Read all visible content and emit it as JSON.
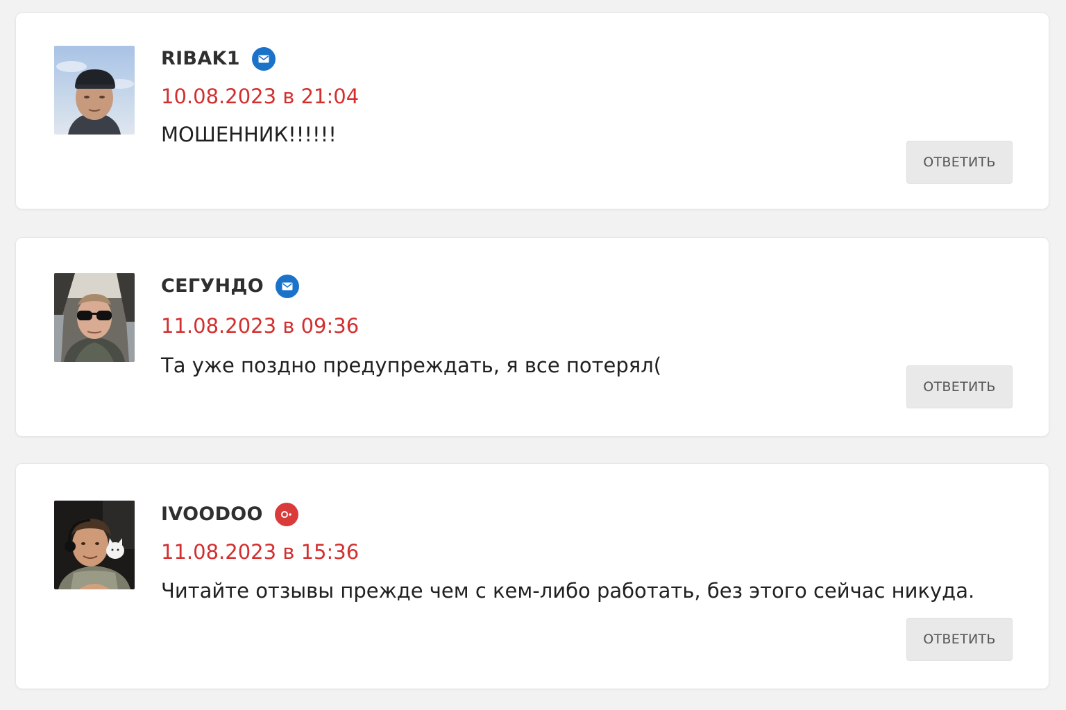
{
  "comments": [
    {
      "author": "RIBAK1",
      "network_icon": "mail-icon",
      "network_color": "#1a73c9",
      "date": "10.08.2023 в 21:04",
      "text": "МОШЕННИК!!!!!!",
      "reply_label": "ОТВЕТИТЬ"
    },
    {
      "author": "СЕГУНДО",
      "network_icon": "mail-icon",
      "network_color": "#1a73c9",
      "date": "11.08.2023 в 09:36",
      "text": "Та уже поздно предупреждать, я все потерял(",
      "reply_label": "ОТВЕТИТЬ"
    },
    {
      "author": "IVOODOO",
      "network_icon": "odnoklassniki-icon",
      "network_color": "#d93b3b",
      "date": "11.08.2023 в 15:36",
      "text": "Читайте отзывы прежде чем с кем-либо работать, без этого сейчас никуда.",
      "reply_label": "ОТВЕТИТЬ"
    }
  ],
  "colors": {
    "page_background": "#f2f2f2",
    "card_background": "#ffffff",
    "date_color": "#d32f2f",
    "button_background": "#e9e9e9"
  }
}
